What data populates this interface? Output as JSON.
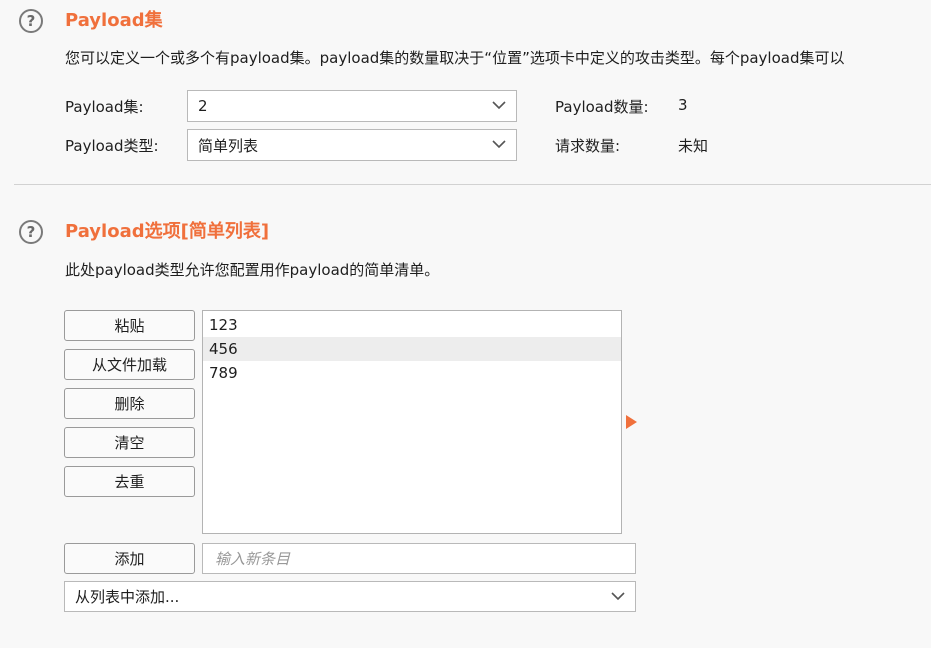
{
  "payload_sets": {
    "help_icon": "question-circle-icon",
    "title": "Payload集",
    "description": "您可以定义一个或多个有payload集。payload集的数量取决于“位置”选项卡中定义的攻击类型。每个payload集可以",
    "set_label": "Payload集:",
    "set_value": "2",
    "type_label": "Payload类型:",
    "type_value": "简单列表",
    "count_label": "Payload数量:",
    "count_value": "3",
    "requests_label": "请求数量:",
    "requests_value": "未知"
  },
  "payload_options": {
    "help_icon": "question-circle-icon",
    "title": "Payload选项[简单列表]",
    "description": "此处payload类型允许您配置用作payload的简单清单。",
    "buttons": {
      "paste": "粘贴",
      "load": "从文件加载",
      "remove": "删除",
      "clear": "清空",
      "dedup": "去重",
      "add": "添加"
    },
    "items": [
      "123",
      "456",
      "789"
    ],
    "selected_index": 1,
    "new_item_placeholder": "输入新条目",
    "add_from_list": "从列表中添加..."
  },
  "colors": {
    "accent": "#f0703c",
    "background": "#f8f8f8"
  }
}
